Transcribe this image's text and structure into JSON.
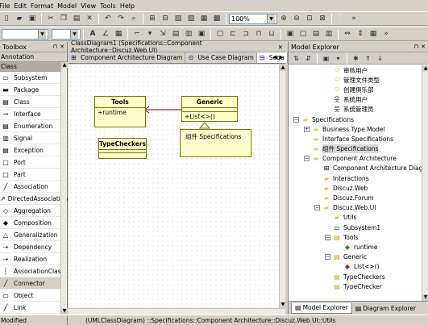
{
  "menu": [
    "File",
    "Edit",
    "Format",
    "Model",
    "View",
    "Tools",
    "Help"
  ],
  "toolbar": {
    "zoom": "100%"
  },
  "toolbox": {
    "title": "Toolbox",
    "section_annotation": "Annotation",
    "section_class": "Class",
    "items": [
      {
        "label": "Subsystem",
        "icon": "subsystem-icon",
        "glyph": "▭"
      },
      {
        "label": "Package",
        "icon": "package-icon",
        "glyph": "▬"
      },
      {
        "label": "Class",
        "icon": "class-icon",
        "glyph": "▤"
      },
      {
        "label": "Interface",
        "icon": "interface-icon",
        "glyph": "⊸"
      },
      {
        "label": "Enumeration",
        "icon": "enumeration-icon",
        "glyph": "▤"
      },
      {
        "label": "Signal",
        "icon": "signal-icon",
        "glyph": "▥"
      },
      {
        "label": "Exception",
        "icon": "exception-icon",
        "glyph": "▤"
      },
      {
        "label": "Port",
        "icon": "port-icon",
        "glyph": "□"
      },
      {
        "label": "Part",
        "icon": "part-icon",
        "glyph": "□"
      },
      {
        "label": "Association",
        "icon": "association-icon",
        "glyph": "╱"
      },
      {
        "label": "DirectedAssociation",
        "icon": "directed-association-icon",
        "glyph": "↗"
      },
      {
        "label": "Aggregation",
        "icon": "aggregation-icon",
        "glyph": "◇"
      },
      {
        "label": "Composition",
        "icon": "composition-icon",
        "glyph": "◆"
      },
      {
        "label": "Generalization",
        "icon": "generalization-icon",
        "glyph": "△"
      },
      {
        "label": "Dependency",
        "icon": "dependency-icon",
        "glyph": "⇢"
      },
      {
        "label": "Realization",
        "icon": "realization-icon",
        "glyph": "⇢"
      },
      {
        "label": "AssociationClass",
        "icon": "association-class-icon",
        "glyph": "┆"
      },
      {
        "label": "Connector",
        "icon": "connector-icon",
        "glyph": "╱"
      },
      {
        "label": "Object",
        "icon": "object-icon",
        "glyph": "▭"
      },
      {
        "label": "Link",
        "icon": "link-icon",
        "glyph": "╱"
      }
    ],
    "selected_index": 17
  },
  "document": {
    "title": "ClassDiagram1 (Specifications::Component Architecture::Discuz.Web.UI)",
    "tabs": [
      {
        "label": "Component Architecture Diagram",
        "active": false
      },
      {
        "label": "Use Case Diagram",
        "active": false
      },
      {
        "label": "Sequ",
        "active": true
      }
    ]
  },
  "diagram": {
    "classes": [
      {
        "id": "tools",
        "name": "Tools",
        "ops": [
          "+runtime"
        ]
      },
      {
        "id": "generic",
        "name": "Generic",
        "ops": [
          "+List<>()"
        ]
      },
      {
        "id": "typecheckers",
        "name": "TypeCheckers",
        "ops": []
      }
    ],
    "package_label": "组件 Specifications"
  },
  "explorer": {
    "title": "Model Explorer",
    "nodes": [
      {
        "label": "审核用户",
        "indent": 3,
        "icon": "ellipse-icon",
        "glyph": "⬭",
        "exp": ""
      },
      {
        "label": "管理文件类型",
        "indent": 3,
        "icon": "ellipse-icon",
        "glyph": "⬭",
        "exp": ""
      },
      {
        "label": "创建俱乐部",
        "indent": 3,
        "icon": "ellipse-icon",
        "glyph": "⬭",
        "exp": ""
      },
      {
        "label": "系统用户",
        "indent": 3,
        "icon": "actor-icon",
        "glyph": "웃",
        "exp": ""
      },
      {
        "label": "系统管理员",
        "indent": 3,
        "icon": "actor-icon",
        "glyph": "웃",
        "exp": ""
      },
      {
        "label": "Specifications",
        "indent": 0,
        "icon": "folder-icon",
        "glyph": "▰",
        "exp": "−"
      },
      {
        "label": "Business Type Model",
        "indent": 1,
        "icon": "folder-icon",
        "glyph": "▰",
        "exp": "+"
      },
      {
        "label": "Interface Specifications",
        "indent": 1,
        "icon": "folder-icon",
        "glyph": "▰",
        "exp": ""
      },
      {
        "label": "组件 Specifications",
        "indent": 1,
        "icon": "folder-icon",
        "glyph": "▰",
        "exp": "",
        "selected": true
      },
      {
        "label": "Component Architecture",
        "indent": 1,
        "icon": "folder-icon",
        "glyph": "▰",
        "exp": "−"
      },
      {
        "label": "Component Architecture Diagr",
        "indent": 2,
        "icon": "diagram-icon",
        "glyph": "⊞",
        "exp": ""
      },
      {
        "label": "Interactions",
        "indent": 2,
        "icon": "folder-icon",
        "glyph": "▰",
        "exp": ""
      },
      {
        "label": "Discuz.Web",
        "indent": 2,
        "icon": "folder-icon",
        "glyph": "▰",
        "exp": ""
      },
      {
        "label": "Discuz.Forum",
        "indent": 2,
        "icon": "folder-icon",
        "glyph": "▰",
        "exp": ""
      },
      {
        "label": "Discuz.Web.UI",
        "indent": 2,
        "icon": "folder-icon",
        "glyph": "▰",
        "exp": "−"
      },
      {
        "label": "Utils",
        "indent": 3,
        "icon": "folder-icon",
        "glyph": "▰",
        "exp": ""
      },
      {
        "label": "Subsystem1",
        "indent": 3,
        "icon": "subsystem-icon",
        "glyph": "▭",
        "exp": ""
      },
      {
        "label": "Tools",
        "indent": 3,
        "icon": "class-icon",
        "glyph": "▤",
        "exp": "−"
      },
      {
        "label": "runtime",
        "indent": 4,
        "icon": "attribute-icon",
        "glyph": "◆",
        "exp": ""
      },
      {
        "label": "Generic",
        "indent": 3,
        "icon": "class-icon",
        "glyph": "▤",
        "exp": "−"
      },
      {
        "label": "List<>()",
        "indent": 4,
        "icon": "operation-icon",
        "glyph": "◆",
        "exp": ""
      },
      {
        "label": "TypeCheckers",
        "indent": 3,
        "icon": "class-icon",
        "glyph": "▤",
        "exp": ""
      },
      {
        "label": "TypeChecker",
        "indent": 3,
        "icon": "class-icon",
        "glyph": "▤",
        "exp": ""
      }
    ],
    "bottom_tabs": [
      {
        "label": "Model Explorer",
        "active": true
      },
      {
        "label": "Diagram Explorer",
        "active": false
      }
    ]
  },
  "status": {
    "modified": "Modified",
    "path": "(UMLClassDiagram) ::Specifications::Component Architecture::Discuz.Web.UI::Utils"
  },
  "colors": {
    "chrome": "#d4d0c8",
    "class_fill": "#ffffcc",
    "class_border": "#7a7a00",
    "association_line": "#800000"
  }
}
